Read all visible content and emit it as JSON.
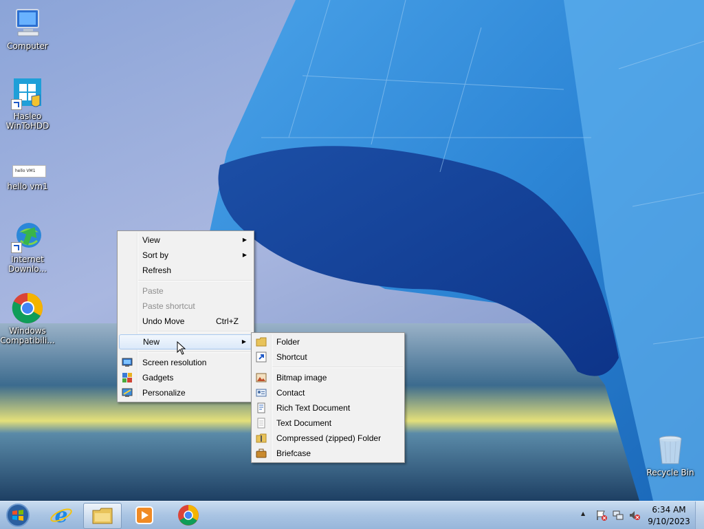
{
  "desktop": {
    "icons": [
      {
        "id": "computer",
        "label": "Computer",
        "icon": "computer-icon"
      },
      {
        "id": "wintohdd",
        "label": "Hasleo WinToHDD",
        "icon": "windows-setup-icon"
      },
      {
        "id": "hello",
        "label": "hello vm1",
        "thumb_text": "hello VM1",
        "icon": "text-file-thumbnail-icon"
      },
      {
        "id": "idm",
        "label": "Internet Downlo...",
        "icon": "internet-download-manager-icon"
      },
      {
        "id": "chrome",
        "label": "Windows Compatibili...",
        "icon": "chrome-icon"
      },
      {
        "id": "recycle",
        "label": "Recycle Bin",
        "icon": "recycle-bin-icon"
      }
    ]
  },
  "context_menu": {
    "items": {
      "view": "View",
      "sort_by": "Sort by",
      "refresh": "Refresh",
      "paste": "Paste",
      "paste_shortcut": "Paste shortcut",
      "undo_move": "Undo Move",
      "undo_move_shortcut": "Ctrl+Z",
      "new": "New",
      "screen_resolution": "Screen resolution",
      "gadgets": "Gadgets",
      "personalize": "Personalize"
    },
    "submenu_arrow": "▶"
  },
  "new_submenu": {
    "items": {
      "folder": "Folder",
      "shortcut": "Shortcut",
      "bitmap": "Bitmap image",
      "contact": "Contact",
      "rtf": "Rich Text Document",
      "txt": "Text Document",
      "zip": "Compressed (zipped) Folder",
      "briefcase": "Briefcase"
    }
  },
  "taskbar": {
    "pinned": [
      {
        "id": "start",
        "icon": "windows-start-orb-icon"
      },
      {
        "id": "ie",
        "icon": "internet-explorer-icon"
      },
      {
        "id": "explorer",
        "icon": "file-explorer-icon",
        "active": true
      },
      {
        "id": "media",
        "icon": "media-player-icon"
      },
      {
        "id": "chrome",
        "icon": "chrome-icon"
      }
    ],
    "tray": {
      "show_hidden": "▲",
      "time": "6:34 AM",
      "date": "9/10/2023"
    }
  },
  "colors": {
    "menu_bg": "#f1f1f1",
    "menu_highlight": "#dbe9f9",
    "taskbar": "#a9c4e3",
    "accent": "#1c57c7"
  }
}
